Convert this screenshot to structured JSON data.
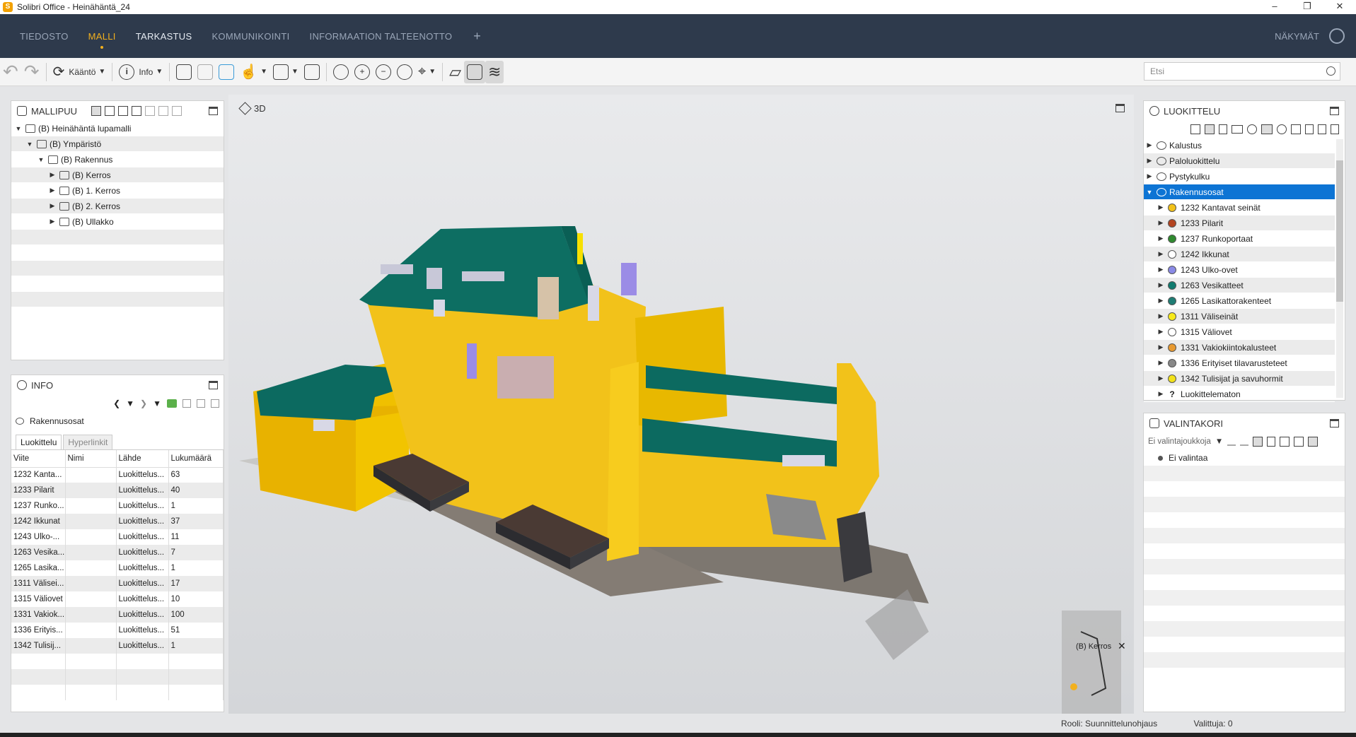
{
  "window": {
    "title": "Solibri Office - Heinähäntä_24",
    "logo": "S"
  },
  "menu": {
    "items": [
      {
        "label": "TIEDOSTO",
        "state": "normal"
      },
      {
        "label": "MALLI",
        "state": "active"
      },
      {
        "label": "TARKASTUS",
        "state": "hl"
      },
      {
        "label": "KOMMUNIKOINTI",
        "state": "normal"
      },
      {
        "label": "INFORMAATION TALTEENOTTO",
        "state": "normal"
      }
    ],
    "plus": "+",
    "views_label": "NÄKYMÄT"
  },
  "toolbar": {
    "rotate_label": "Kääntö",
    "info_label": "Info"
  },
  "search": {
    "placeholder": "Etsi"
  },
  "model_tree": {
    "title": "MALLIPUU",
    "rows": [
      {
        "label": "(B) Heinähäntä lupamalli",
        "indent": 0,
        "arrow": "▼"
      },
      {
        "label": "(B) Ympäristö",
        "indent": 1,
        "arrow": "▼"
      },
      {
        "label": "(B) Rakennus",
        "indent": 2,
        "arrow": "▼"
      },
      {
        "label": "(B) Kerros",
        "indent": 3,
        "arrow": "▶"
      },
      {
        "label": "(B) 1. Kerros",
        "indent": 3,
        "arrow": "▶"
      },
      {
        "label": "(B) 2. Kerros",
        "indent": 3,
        "arrow": "▶"
      },
      {
        "label": "(B) Ullakko",
        "indent": 3,
        "arrow": "▶"
      }
    ]
  },
  "info": {
    "title": "INFO",
    "subject": "Rakennusosat",
    "tabs": [
      "Luokittelu",
      "Hyperlinkit"
    ],
    "columns": [
      "Viite",
      "Nimi",
      "Lähde",
      "Lukumäärä"
    ],
    "rows": [
      [
        "1232 Kanta...",
        "",
        "Luokittelus...",
        "63"
      ],
      [
        "1233 Pilarit",
        "",
        "Luokittelus...",
        "40"
      ],
      [
        "1237 Runko...",
        "",
        "Luokittelus...",
        "1"
      ],
      [
        "1242 Ikkunat",
        "",
        "Luokittelus...",
        "37"
      ],
      [
        "1243 Ulko-...",
        "",
        "Luokittelus...",
        "11"
      ],
      [
        "1263 Vesika...",
        "",
        "Luokittelus...",
        "7"
      ],
      [
        "1265 Lasika...",
        "",
        "Luokittelus...",
        "1"
      ],
      [
        "1311 Välisei...",
        "",
        "Luokittelus...",
        "17"
      ],
      [
        "1315 Väliovet",
        "",
        "Luokittelus...",
        "10"
      ],
      [
        "1331 Vakiok...",
        "",
        "Luokittelus...",
        "100"
      ],
      [
        "1336 Erityis...",
        "",
        "Luokittelus...",
        "51"
      ],
      [
        "1342 Tulisij...",
        "",
        "Luokittelus...",
        "1"
      ]
    ]
  },
  "viewport": {
    "label": "3D",
    "minimap_label": "(B) Kerros"
  },
  "classification": {
    "title": "LUOKITTELU",
    "groups": [
      {
        "label": "Kalustus",
        "selected": false
      },
      {
        "label": "Paloluokittelu",
        "selected": false
      },
      {
        "label": "Pystykulku",
        "selected": false
      },
      {
        "label": "Rakennusosat",
        "selected": true
      }
    ],
    "items": [
      {
        "label": "1232 Kantavat seinät",
        "color": "#f2c21a"
      },
      {
        "label": "1233 Pilarit",
        "color": "#b3431f"
      },
      {
        "label": "1237 Runkoportaat",
        "color": "#2f8a2f"
      },
      {
        "label": "1242 Ikkunat",
        "color": "#ffffff"
      },
      {
        "label": "1243 Ulko-ovet",
        "color": "#8a8ae6"
      },
      {
        "label": "1263 Vesikatteet",
        "color": "#0f7a6e"
      },
      {
        "label": "1265 Lasikattorakenteet",
        "color": "#1f7d74"
      },
      {
        "label": "1311 Väliseinät",
        "color": "#f7ea1a"
      },
      {
        "label": "1315 Väliovet",
        "color": "#ffffff"
      },
      {
        "label": "1331 Vakiokiintokalusteet",
        "color": "#e89a30"
      },
      {
        "label": "1336 Erityiset tilavarusteteet",
        "color": "#888888"
      },
      {
        "label": "1342 Tulisijat ja savuhormit",
        "color": "#f2e21a"
      },
      {
        "label": "Luokittelematon",
        "color": "none"
      }
    ]
  },
  "selection_basket": {
    "title": "VALINTAKORI",
    "dropdown": "Ei valintajoukkoja",
    "item": "Ei valintaa"
  },
  "status": {
    "role": "Rooli: Suunnittelunohjaus",
    "selected": "Valittuja: 0"
  },
  "colors": {
    "menubar": "#2e3a4c",
    "accent": "#f2b01e",
    "selection": "#0d74d4",
    "roof": "#0f6e63",
    "walls": "#f2c21a"
  }
}
